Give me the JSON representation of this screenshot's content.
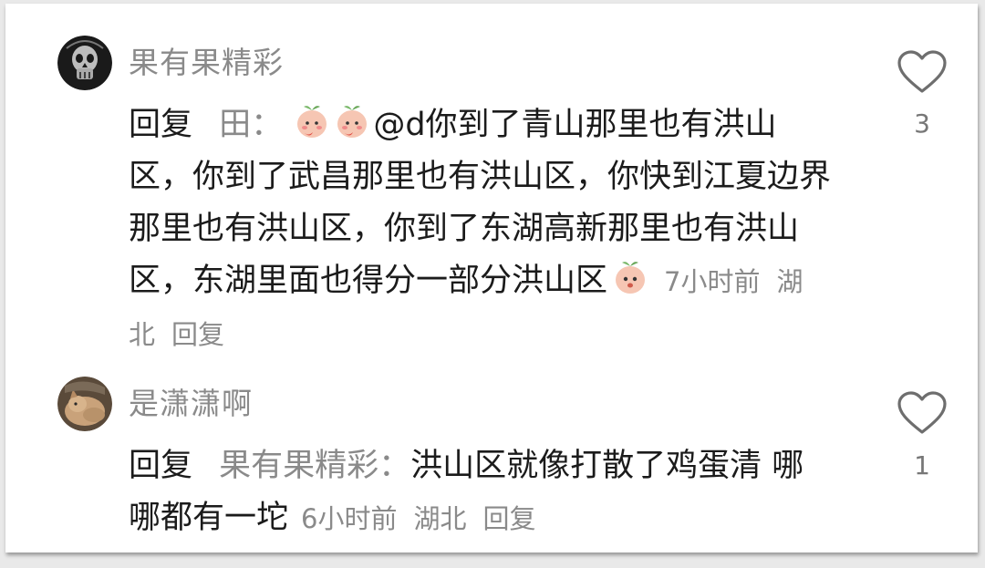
{
  "comments": [
    {
      "username": "果有果精彩",
      "reply_prefix": "回复",
      "reply_to": "田：",
      "text": "@d你到了青山那里也有洪山区，你到了武昌那里也有洪山区，你快到江夏边界那里也有洪山区，你到了东湖高新那里也有洪山区，东湖里面也得分一部分洪山区",
      "time": "7小时前",
      "location": "湖北",
      "reply_label": "回复",
      "likes": "3",
      "avatar_icon": "skull-avatar",
      "emoji_icon": "peach-emoji"
    },
    {
      "username": "是潇潇啊",
      "reply_prefix": "回复",
      "reply_to": "果有果精彩：",
      "text": "洪山区就像打散了鸡蛋清 哪哪都有一坨",
      "time": "6小时前",
      "location": "湖北",
      "reply_label": "回复",
      "likes": "1",
      "avatar_icon": "cat-avatar"
    }
  ],
  "colors": {
    "text": "#1b1b1b",
    "muted": "#8a8a8a",
    "background": "#ffffff"
  }
}
